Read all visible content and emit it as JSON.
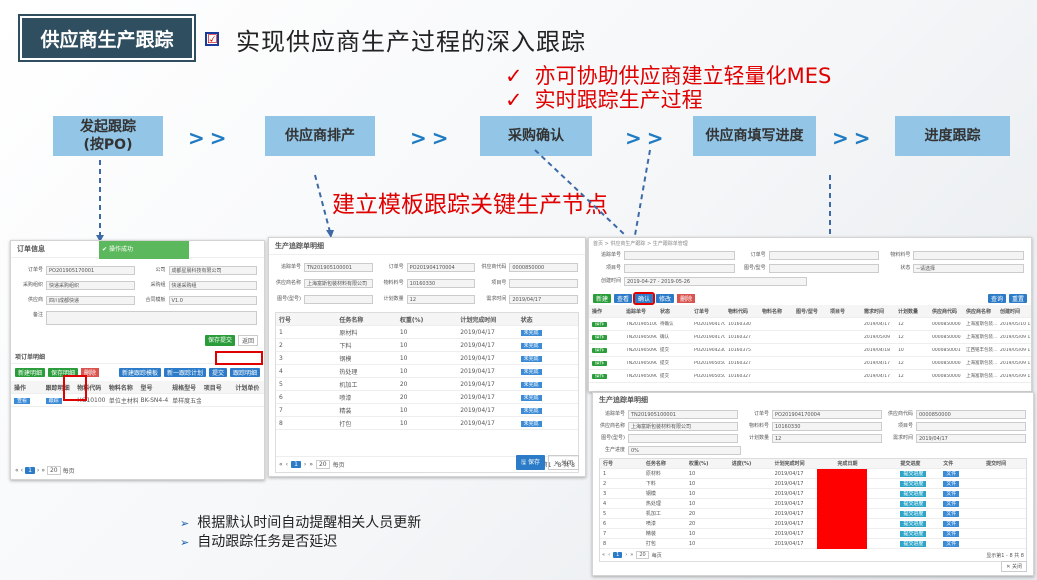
{
  "header": {
    "tag": "供应商生产跟踪",
    "checkbox": "☑",
    "headline": "实现供应商生产过程的深入跟踪",
    "points": [
      {
        "check": "✓",
        "text": "亦可协助供应商建立轻量化MES"
      },
      {
        "check": "✓",
        "text": "实时跟踪生产过程"
      }
    ]
  },
  "flow": {
    "steps": [
      {
        "line1": "发起跟踪",
        "line2": "(按PO)"
      },
      {
        "line1": "供应商排产",
        "line2": ""
      },
      {
        "line1": "采购确认",
        "line2": ""
      },
      {
        "line1": "供应商填写进度",
        "line2": ""
      },
      {
        "line1": "进度跟踪",
        "line2": ""
      }
    ],
    "arrow": ">>"
  },
  "note": "建立模板跟踪关键生产节点",
  "bullets": [
    "根据默认时间自动提醒相关人员更新",
    "自动跟踪任务是否延迟"
  ],
  "bullet_marker": "➢",
  "shot1": {
    "title": "订单信息",
    "toast": "操作成功",
    "fields": [
      {
        "label": "订单号",
        "value": "PO201905170001"
      },
      {
        "label": "公司",
        "value": "成都星晨科技有限公司"
      },
      {
        "label": "采购组织",
        "value": "快递采购组织"
      },
      {
        "label": "采购组",
        "value": "快递采购组"
      },
      {
        "label": "供应商",
        "value": "四川成都快递"
      },
      {
        "label": "合同模板",
        "value": "V1.0"
      },
      {
        "label": "备注",
        "value": ""
      }
    ],
    "btn_save": "保存提交",
    "btn_back": "返回",
    "section": "项订单明细",
    "actions": [
      "新建明细",
      "保存明细",
      "删除",
      "新建跟踪模板",
      "新一跟踪计划",
      "提交",
      "跟踪明细"
    ],
    "cols": [
      "操作",
      "跟踪明细",
      "物料代码",
      "物料名称",
      "型号",
      "规格型号",
      "项目号",
      "计划单价"
    ],
    "row": [
      "查看",
      "跟踪",
      "HG10100100001",
      "单位主材料",
      "BK-SN4-415",
      "单样度五金配件",
      "",
      ""
    ],
    "pager": [
      "«",
      "‹",
      "1",
      "›",
      "»",
      "20",
      "每页"
    ]
  },
  "shot2": {
    "title": "生产追踪单明细",
    "fields": [
      {
        "label": "追踪单号",
        "value": "TN201905100001"
      },
      {
        "label": "订单号",
        "value": "PO201904170004"
      },
      {
        "label": "供应商代码",
        "value": "0000850000"
      },
      {
        "label": "供应商名称",
        "value": "上海富斯包装材料有限公司"
      },
      {
        "label": "物料料号",
        "value": "10160330"
      },
      {
        "label": "项目号",
        "value": ""
      },
      {
        "label": "图号(型号)",
        "value": ""
      },
      {
        "label": "计划数量",
        "value": "12"
      },
      {
        "label": "需求时间",
        "value": "2019/04/17"
      }
    ],
    "cols": [
      "行号",
      "任务名称",
      "权重(%)",
      "计划完成时间",
      "状态"
    ],
    "rows": [
      [
        "1",
        "原材料",
        "10",
        "2019/04/17",
        "未完成"
      ],
      [
        "2",
        "下料",
        "10",
        "2019/04/17",
        "未完成"
      ],
      [
        "3",
        "钢模",
        "10",
        "2019/04/17",
        "未完成"
      ],
      [
        "4",
        "热处理",
        "10",
        "2019/04/17",
        "未完成"
      ],
      [
        "5",
        "机加工",
        "20",
        "2019/04/17",
        "未完成"
      ],
      [
        "6",
        "喷漆",
        "20",
        "2019/04/17",
        "未完成"
      ],
      [
        "7",
        "精装",
        "10",
        "2019/04/17",
        "未完成"
      ],
      [
        "8",
        "打包",
        "10",
        "2019/04/17",
        "未完成"
      ]
    ],
    "pager": [
      "«",
      "‹",
      "1",
      "›",
      "»",
      "20",
      "每页",
      "显示第1 - 8 共 8"
    ],
    "btn_save": "保存",
    "btn_close": "关闭"
  },
  "shot3": {
    "breadcrumb": "首页 > 供应商生产跟踪 > 生产跟踪单管理",
    "filters": [
      {
        "label": "追踪单号",
        "value": ""
      },
      {
        "label": "订单号",
        "value": ""
      },
      {
        "label": "物料料号",
        "value": ""
      },
      {
        "label": "项目号",
        "value": ""
      },
      {
        "label": "图号/型号",
        "value": ""
      },
      {
        "label": "状态",
        "value": "--请选择"
      },
      {
        "label": "创建时间",
        "value": "2019-04-27 - 2019-05-26"
      }
    ],
    "actions": [
      "新建",
      "查看",
      "确认",
      "修改",
      "删除"
    ],
    "right_actions": [
      "查询",
      "重置"
    ],
    "cols": [
      "操作",
      "追踪单号",
      "状态",
      "订单号",
      "物料代码",
      "物料名称",
      "图号/型号",
      "项目号",
      "需求时间",
      "计划数量",
      "供应商代码",
      "供应商名称",
      "创建时间"
    ],
    "rows": [
      [
        "操作",
        "TN201905100001",
        "待确认",
        "PO201904170004",
        "10160330",
        "",
        "",
        "",
        "2019/04/17",
        "12",
        "0000850000",
        "上海富斯包装...",
        "2019/05/10 11:04:15"
      ],
      [
        "操作",
        "TN201905090004",
        "确认",
        "PO201904170004",
        "10160327",
        "",
        "",
        "",
        "2019/05/09",
        "12",
        "0000850000",
        "上海富斯包装...",
        "2019/05/09 17:40:45"
      ],
      [
        "操作",
        "TN201905090003",
        "提交",
        "PO201904230004",
        "10160375",
        "",
        "",
        "",
        "2019/04/18",
        "10",
        "0000850001",
        "江西铭丰包装...",
        "2019/05/09 17:06:59"
      ],
      [
        "操作",
        "TN201905090002",
        "提交",
        "PO201905050001",
        "10160327",
        "",
        "",
        "",
        "2019/04/17",
        "12",
        "0000850000",
        "上海富斯包装...",
        "2019/05/09 11:02:34"
      ],
      [
        "操作",
        "TN201905090001",
        "提交",
        "PO201905050001",
        "10160327",
        "",
        "",
        "",
        "2019/04/17",
        "12",
        "0000850000",
        "上海富斯包装...",
        "2019/05/09 11:00:38"
      ]
    ]
  },
  "shot4": {
    "title": "生产追踪单明细",
    "fields": [
      {
        "label": "追踪单号",
        "value": "TN201905100001"
      },
      {
        "label": "订单号",
        "value": "PO201904170004"
      },
      {
        "label": "供应商代码",
        "value": "0000850000"
      },
      {
        "label": "供应商名称",
        "value": "上海富斯包装材料有限公司"
      },
      {
        "label": "物料料号",
        "value": "10160330"
      },
      {
        "label": "项目号",
        "value": ""
      },
      {
        "label": "图号(型号)",
        "value": ""
      },
      {
        "label": "计划数量",
        "value": "12"
      },
      {
        "label": "需求时间",
        "value": "2019/04/17"
      },
      {
        "label": "生产进度",
        "value": "0%"
      }
    ],
    "cols": [
      "行号",
      "任务名称",
      "权重(%)",
      "进度(%)",
      "计划完成时间",
      "完成日期",
      "提交进度",
      "文件",
      "提交时间"
    ],
    "rows": [
      [
        "1",
        "原材料",
        "10",
        "",
        "2019/04/17"
      ],
      [
        "2",
        "下料",
        "10",
        "",
        "2019/04/17"
      ],
      [
        "3",
        "钢模",
        "10",
        "",
        "2019/04/17"
      ],
      [
        "4",
        "热处理",
        "10",
        "",
        "2019/04/17"
      ],
      [
        "5",
        "机加工",
        "20",
        "",
        "2019/04/17"
      ],
      [
        "6",
        "喷漆",
        "20",
        "",
        "2019/04/17"
      ],
      [
        "7",
        "精装",
        "10",
        "",
        "2019/04/17"
      ],
      [
        "8",
        "打包",
        "10",
        "",
        "2019/04/17"
      ]
    ],
    "submit": "提交进度",
    "file": "文件",
    "pager": [
      "«",
      "‹",
      "1",
      "›",
      "»",
      "20",
      "每页",
      "显示第1 - 8 共 8"
    ],
    "btn_close": "关闭"
  }
}
